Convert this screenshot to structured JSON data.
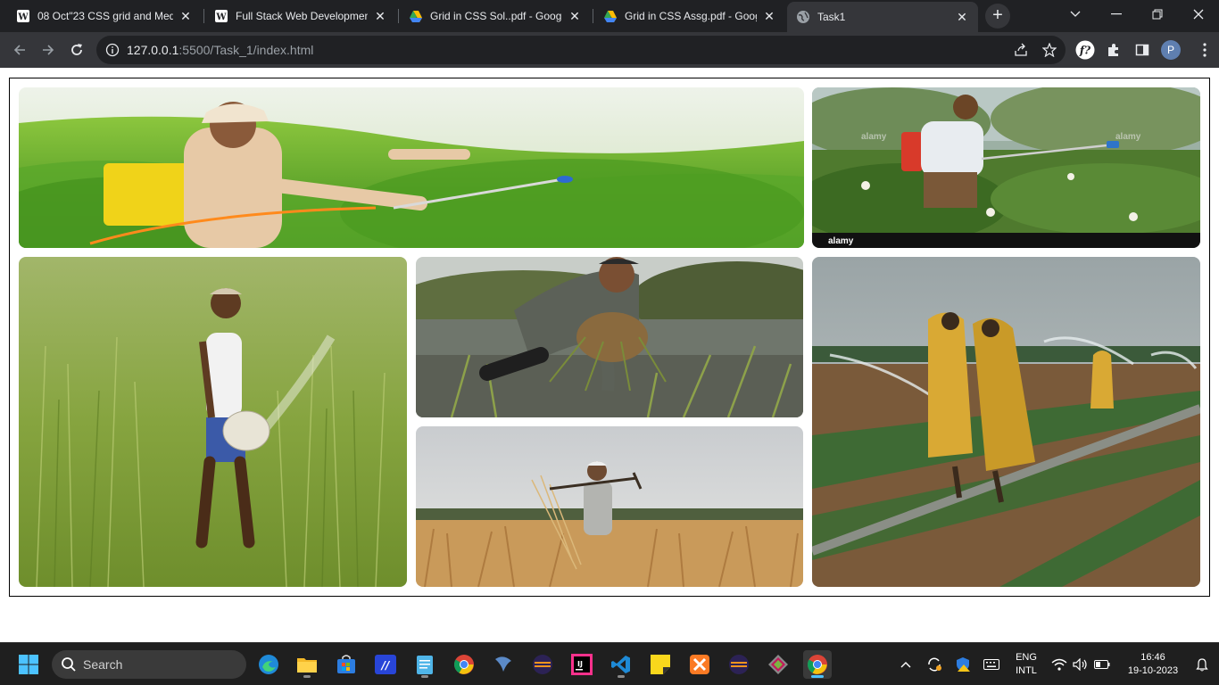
{
  "browser": {
    "tabs": [
      {
        "title": "08 Oct\"23 CSS grid and Med",
        "favicon": "wordpress-icon",
        "active": false
      },
      {
        "title": "Full Stack Web Development",
        "favicon": "wordpress-icon",
        "active": false
      },
      {
        "title": "Grid in CSS Sol..pdf - Google",
        "favicon": "google-drive-icon",
        "active": false
      },
      {
        "title": "Grid in CSS Assg.pdf - Goog",
        "favicon": "google-drive-icon",
        "active": false
      },
      {
        "title": "Task1",
        "favicon": "globe-icon",
        "active": true
      }
    ],
    "tab_close_glyph": "✕",
    "new_tab_glyph": "+",
    "address": {
      "host": "127.0.0.1",
      "path": ":5500/Task_1/index.html"
    },
    "profile_initial": "P"
  },
  "gallery": {
    "images": [
      {
        "subject": "farmer-spraying-crops",
        "watermark": ""
      },
      {
        "subject": "farmer-spraying-cotton",
        "watermark": "alamy"
      },
      {
        "subject": "farmer-sowing-rice",
        "watermark": ""
      },
      {
        "subject": "farmer-planting-seedlings",
        "watermark": ""
      },
      {
        "subject": "farmer-in-wheat-field",
        "watermark": ""
      },
      {
        "subject": "workers-irrigation-sprinklers",
        "watermark": ""
      }
    ]
  },
  "taskbar": {
    "search_label": "Search",
    "language": "ENG",
    "layout": "INTL",
    "time": "16:46",
    "date": "19-10-2023",
    "pinned_apps": [
      "edge-icon",
      "file-explorer-icon",
      "store-icon",
      "app-icon",
      "notepad-icon",
      "chrome-icon",
      "app-icon",
      "eclipse-icon",
      "intellij-icon",
      "vscode-icon",
      "sticky-notes-icon",
      "xampp-icon",
      "eclipse-icon",
      "git-icon",
      "chrome-icon"
    ]
  },
  "colors": {
    "tab_strip": "#202124",
    "toolbar": "#35363a",
    "taskbar": "#1f1f1f",
    "accent": "#4cc2ff"
  }
}
